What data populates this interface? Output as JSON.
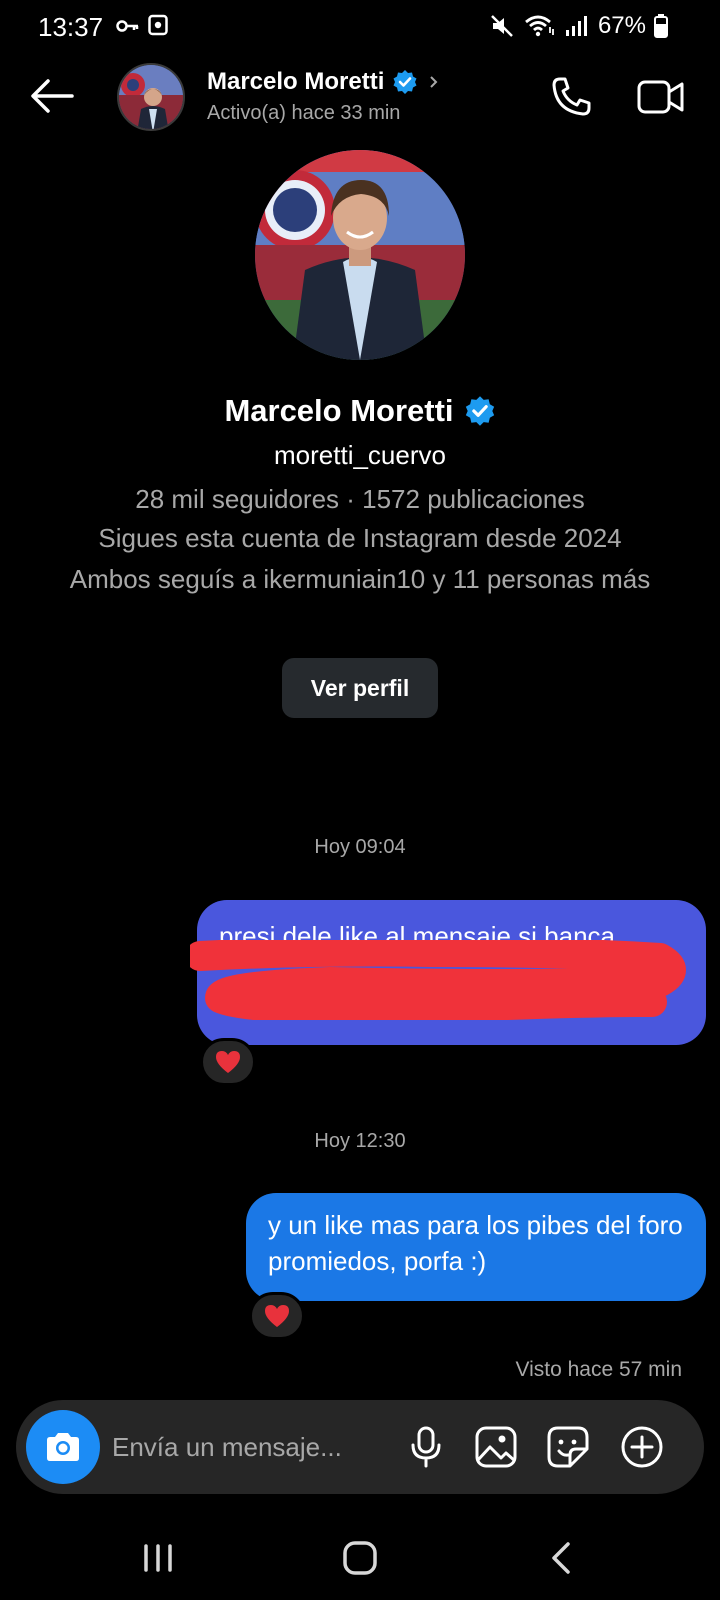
{
  "status_bar": {
    "time": "13:37",
    "battery": "67%"
  },
  "header": {
    "name": "Marcelo Moretti",
    "status": "Activo(a) hace 33 min"
  },
  "profile": {
    "name": "Marcelo Moretti",
    "handle": "moretti_cuervo",
    "stats": "28 mil seguidores · 1572 publicaciones",
    "following_since": "Sigues esta cuenta de Instagram desde 2024",
    "mutual": "Ambos seguís a ikermuniain10 y 11 personas más",
    "view_profile_label": "Ver perfil"
  },
  "messages": [
    {
      "timestamp": "Hoy 09:04",
      "text": "presi dele like al mensaje si banca",
      "reaction": "❤️"
    },
    {
      "timestamp": "Hoy 12:30",
      "text": "y un like mas para los pibes del foro promiedos, porfa :)",
      "reaction": "❤️"
    }
  ],
  "seen": "Visto hace 57 min",
  "composer": {
    "placeholder": "Envía un mensaje..."
  },
  "colors": {
    "bubble_1": "#4a57dd",
    "bubble_2": "#1b78e6",
    "verified": "#1d9bf0",
    "camera_button": "#1c8cf5",
    "redaction": "#f0323a"
  }
}
